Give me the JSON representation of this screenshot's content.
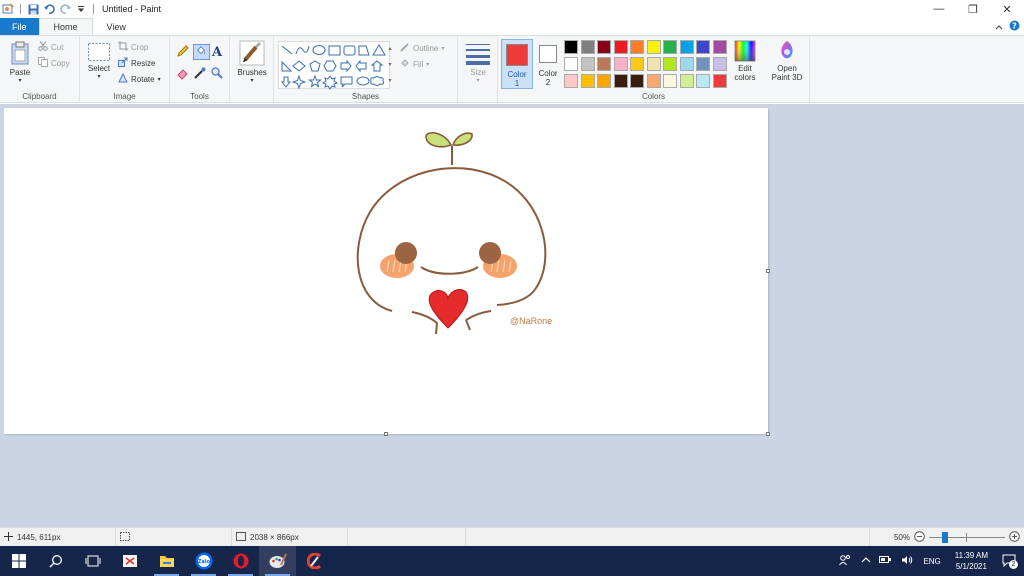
{
  "window": {
    "title": "Untitled - Paint",
    "controls": {
      "minimize": "—",
      "restore": "❐",
      "close": "✕"
    }
  },
  "tabs": [
    {
      "label": "File"
    },
    {
      "label": "Home"
    },
    {
      "label": "View"
    }
  ],
  "ribbon": {
    "clipboard": {
      "group": "Clipboard",
      "paste": "Paste",
      "cut": "Cut",
      "copy": "Copy"
    },
    "image": {
      "group": "Image",
      "select": "Select",
      "crop": "Crop",
      "resize": "Resize",
      "rotate": "Rotate"
    },
    "tools": {
      "group": "Tools"
    },
    "brushes": {
      "label": "Brushes"
    },
    "shapes": {
      "group": "Shapes",
      "outline": "Outline",
      "fill": "Fill"
    },
    "size": {
      "label": "Size"
    },
    "color1": {
      "label1": "Color",
      "label2": "1",
      "value": "#ee3a3b"
    },
    "color2": {
      "label1": "Color",
      "label2": "2",
      "value": "#ffffff"
    },
    "colors": {
      "group": "Colors",
      "row1": [
        "#000000",
        "#7f7f7f",
        "#880015",
        "#ed1c24",
        "#ff7f27",
        "#fff200",
        "#22b14c",
        "#00a2e8",
        "#3f48cc",
        "#a349a4"
      ],
      "row2": [
        "#ffffff",
        "#c3c3c3",
        "#b97a57",
        "#ffaec9",
        "#ffc90e",
        "#efe4b0",
        "#b5e61d",
        "#99d9ea",
        "#7092be",
        "#c8bfe7"
      ],
      "row3": [
        "#ffc8c8",
        "#ffc000",
        "#ffa500",
        "#3a1e10",
        "#3a1e10",
        "#f9a870",
        "#fcf8e0",
        "#d0f090",
        "#b8e8f4",
        "#ee3a3b"
      ]
    },
    "edit_colors": {
      "line1": "Edit",
      "line2": "colors"
    },
    "paint3d": {
      "line1": "Open",
      "line2": "Paint 3D"
    }
  },
  "canvas": {
    "signature": "@NaRone"
  },
  "status": {
    "cursor": "1445, 611px",
    "size": "2038 × 866px",
    "zoom": "50%"
  },
  "taskbar": {
    "apps": [
      "Start",
      "Search",
      "Task View",
      "Snipping",
      "File Explorer",
      "Zalo",
      "Opera",
      "Paint",
      "Ccleaner"
    ],
    "lang": "ENG",
    "time": "11:39 AM",
    "date": "5/1/2021",
    "notifications": "2"
  }
}
